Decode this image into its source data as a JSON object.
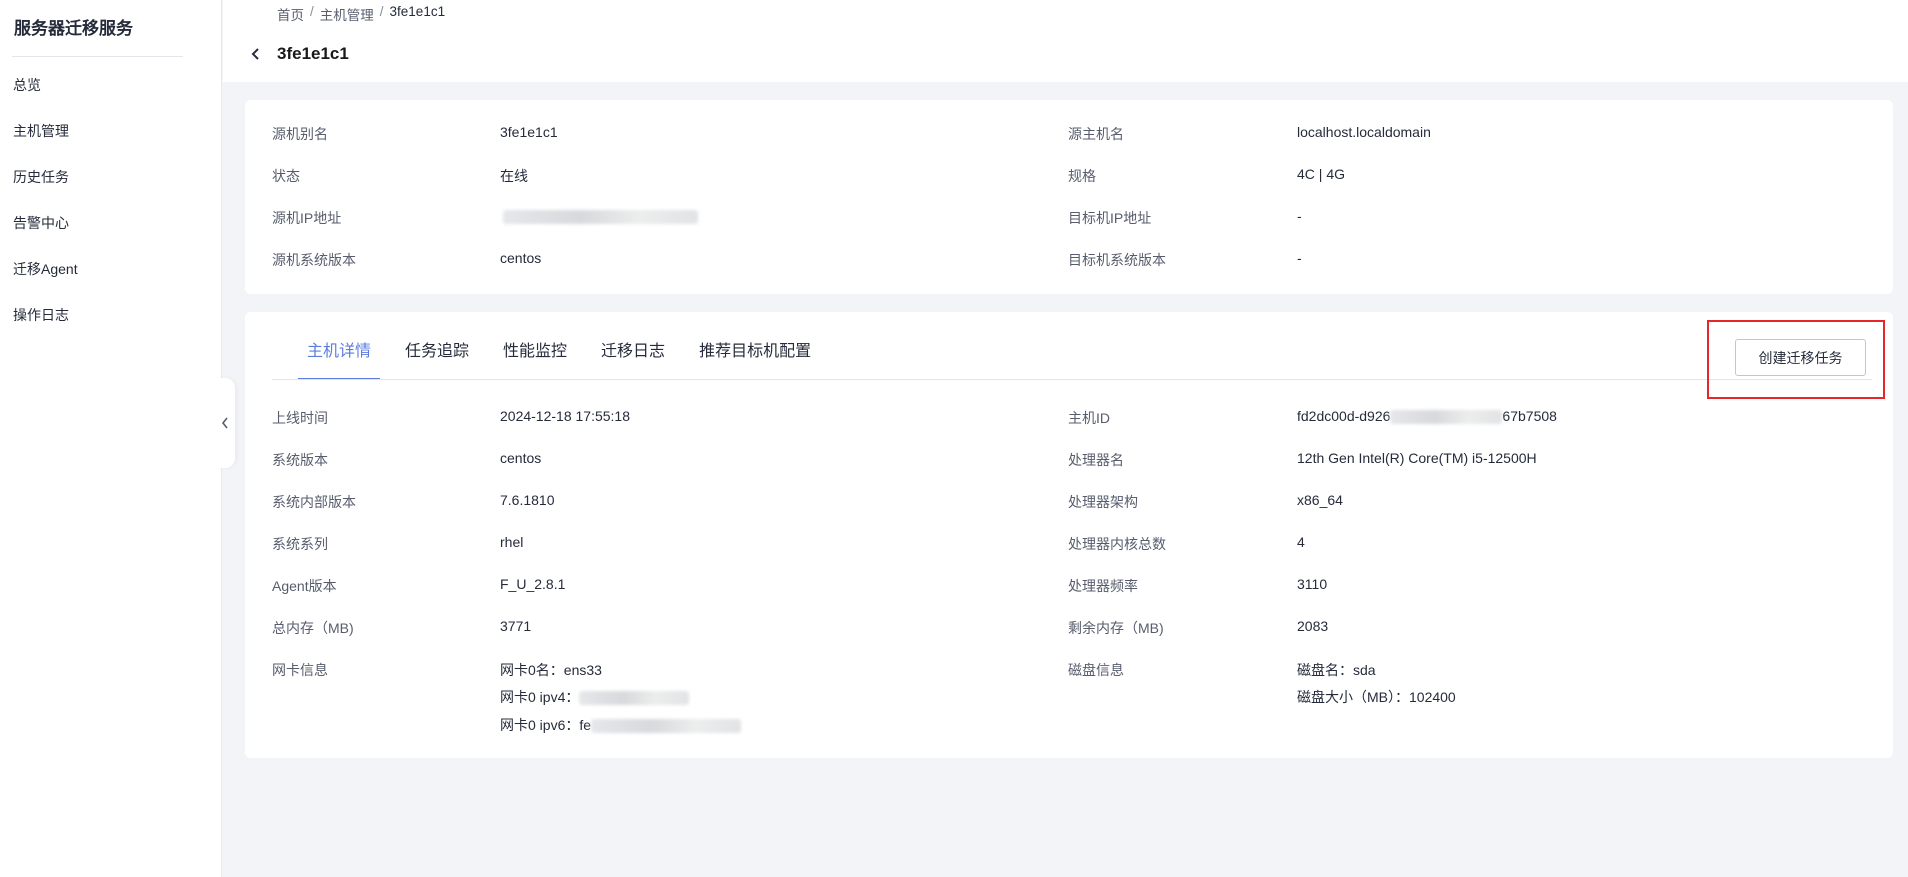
{
  "sidebar": {
    "title": "服务器迁移服务",
    "items": [
      {
        "label": "总览"
      },
      {
        "label": "主机管理"
      },
      {
        "label": "历史任务"
      },
      {
        "label": "告警中心"
      },
      {
        "label": "迁移Agent"
      },
      {
        "label": "操作日志"
      }
    ],
    "collapse_icon": "chevron-left-icon"
  },
  "header": {
    "breadcrumb": [
      "首页",
      "主机管理",
      "3fe1e1c1"
    ],
    "breadcrumb_separator": "/",
    "title": "3fe1e1c1",
    "back_icon": "chevron-left-icon"
  },
  "info": {
    "left": [
      {
        "label": "源机别名",
        "value": "3fe1e1c1"
      },
      {
        "label": "状态",
        "value": "在线"
      },
      {
        "label": "源机IP地址",
        "value": ""
      },
      {
        "label": "源机系统版本",
        "value": "centos"
      }
    ],
    "right": [
      {
        "label": "源主机名",
        "value": "localhost.localdomain"
      },
      {
        "label": "规格",
        "value": "4C | 4G"
      },
      {
        "label": "目标机IP地址",
        "value": "-"
      },
      {
        "label": "目标机系统版本",
        "value": "-"
      }
    ]
  },
  "tabs": [
    {
      "label": "主机详情",
      "active": true
    },
    {
      "label": "任务追踪",
      "active": false
    },
    {
      "label": "性能监控",
      "active": false
    },
    {
      "label": "迁移日志",
      "active": false
    },
    {
      "label": "推荐目标机配置",
      "active": false
    }
  ],
  "create_button": {
    "label": "创建迁移任务"
  },
  "detail": {
    "left": [
      {
        "label": "上线时间",
        "value": "2024-12-18 17:55:18"
      },
      {
        "label": "系统版本",
        "value": "centos"
      },
      {
        "label": "系统内部版本",
        "value": "7.6.1810"
      },
      {
        "label": "系统系列",
        "value": "rhel"
      },
      {
        "label": "Agent版本",
        "value": "F_U_2.8.1"
      },
      {
        "label": "总内存（MB)",
        "value": "3771"
      },
      {
        "label": "网卡信息",
        "lines": [
          "网卡0名：ens33",
          "网卡0 ipv4：",
          "网卡0 ipv6：fe"
        ]
      }
    ],
    "right": [
      {
        "label": "主机ID",
        "value_prefix": "fd2dc00d-d926",
        "value_suffix": "67b7508"
      },
      {
        "label": "处理器名",
        "value": "12th Gen Intel(R) Core(TM) i5-12500H"
      },
      {
        "label": "处理器架构",
        "value": "x86_64"
      },
      {
        "label": "处理器内核总数",
        "value": "4"
      },
      {
        "label": "处理器频率",
        "value": "3110"
      },
      {
        "label": "剩余内存（MB)",
        "value": "2083"
      },
      {
        "label": "磁盘信息",
        "lines": [
          "磁盘名：sda",
          "磁盘大小（MB）：102400"
        ]
      }
    ]
  },
  "colors": {
    "accent": "#5e7ce0",
    "highlight": "#e8262a",
    "background": "#f3f4f7"
  }
}
